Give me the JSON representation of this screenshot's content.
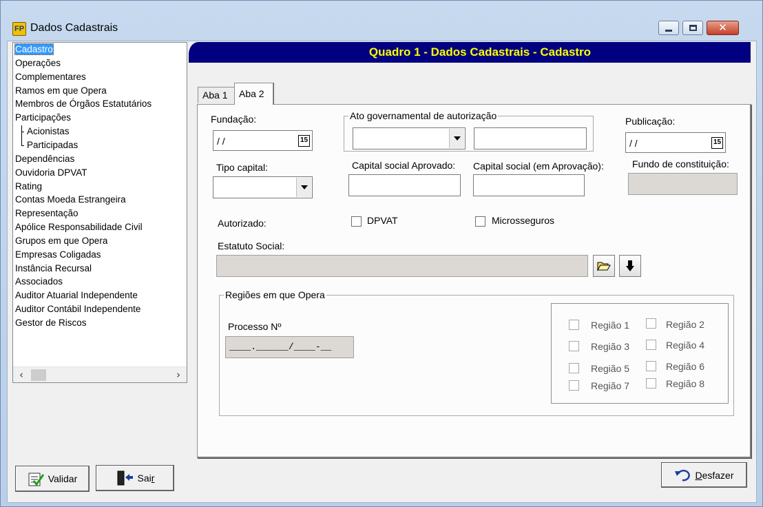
{
  "window": {
    "title": "Dados Cadastrais",
    "app_icon_text": "FP"
  },
  "nav": {
    "items": [
      {
        "label": "Cadastro",
        "selected": true
      },
      {
        "label": "Operações"
      },
      {
        "label": "Complementares"
      },
      {
        "label": "Ramos em que Opera"
      },
      {
        "label": "Membros de Órgãos Estatutários"
      },
      {
        "label": "Participações"
      },
      {
        "label": "Acionistas",
        "child": true
      },
      {
        "label": "Participadas",
        "child": true
      },
      {
        "label": "Dependências"
      },
      {
        "label": "Ouvidoria DPVAT"
      },
      {
        "label": "Rating"
      },
      {
        "label": "Contas Moeda Estrangeira"
      },
      {
        "label": "Representação"
      },
      {
        "label": "Apólice Responsabilidade Civil"
      },
      {
        "label": "Grupos em que Opera"
      },
      {
        "label": "Empresas Coligadas"
      },
      {
        "label": "Instância Recursal"
      },
      {
        "label": "Associados"
      },
      {
        "label": "Auditor Atuarial Independente"
      },
      {
        "label": "Auditor Contábil Independente"
      },
      {
        "label": "Gestor de Riscos"
      }
    ]
  },
  "banner": {
    "title": "Quadro 1 - Dados Cadastrais - Cadastro"
  },
  "tabs": [
    {
      "label": "Aba 1",
      "active": false
    },
    {
      "label": "Aba 2",
      "active": true
    }
  ],
  "form": {
    "fundacao": {
      "label": "Fundação:",
      "value": "/ /",
      "calendar_icon": "15"
    },
    "ato": {
      "label": "Ato governamental de autorização",
      "select_value": "",
      "text_value": ""
    },
    "publicacao": {
      "label": "Publicação:",
      "value": "/ /",
      "calendar_icon": "15"
    },
    "tipo_capital": {
      "label": "Tipo capital:",
      "value": ""
    },
    "capital_aprovado": {
      "label": "Capital social Aprovado:",
      "value": ""
    },
    "capital_em_aprovacao": {
      "label": "Capital social (em Aprovação):",
      "value": ""
    },
    "fundo_constituicao": {
      "label": "Fundo de constituição:",
      "value": ""
    },
    "autorizado": {
      "label": "Autorizado:",
      "options": [
        {
          "label": "DPVAT",
          "checked": false
        },
        {
          "label": "Microsseguros",
          "checked": false
        }
      ]
    },
    "estatuto": {
      "label": "Estatuto Social:",
      "value": "",
      "open_icon": "folder-open-icon",
      "download_icon": "arrow-down-icon"
    },
    "regioes": {
      "title": "Regiões em que Opera",
      "processo_label": "Processo Nº",
      "processo_mask": "____.______/____-__",
      "regions": [
        {
          "label": "Região 1",
          "checked": false
        },
        {
          "label": "Região 2",
          "checked": false
        },
        {
          "label": "Região 3",
          "checked": false
        },
        {
          "label": "Região 4",
          "checked": false
        },
        {
          "label": "Região 5",
          "checked": false
        },
        {
          "label": "Região 6",
          "checked": false
        },
        {
          "label": "Região 7",
          "checked": false
        },
        {
          "label": "Região 8",
          "checked": false
        }
      ]
    }
  },
  "buttons": {
    "validar": {
      "label": "Validar",
      "icon": "checklist-icon"
    },
    "sair_prefix": "Sai",
    "sair_accel": "r",
    "desfazer_accel": "D",
    "desfazer_rest": "esfazer",
    "desfazer_icon": "undo-icon"
  },
  "colors": {
    "banner_bg": "#000080",
    "banner_text": "#ffff00",
    "selection": "#3399ff"
  }
}
